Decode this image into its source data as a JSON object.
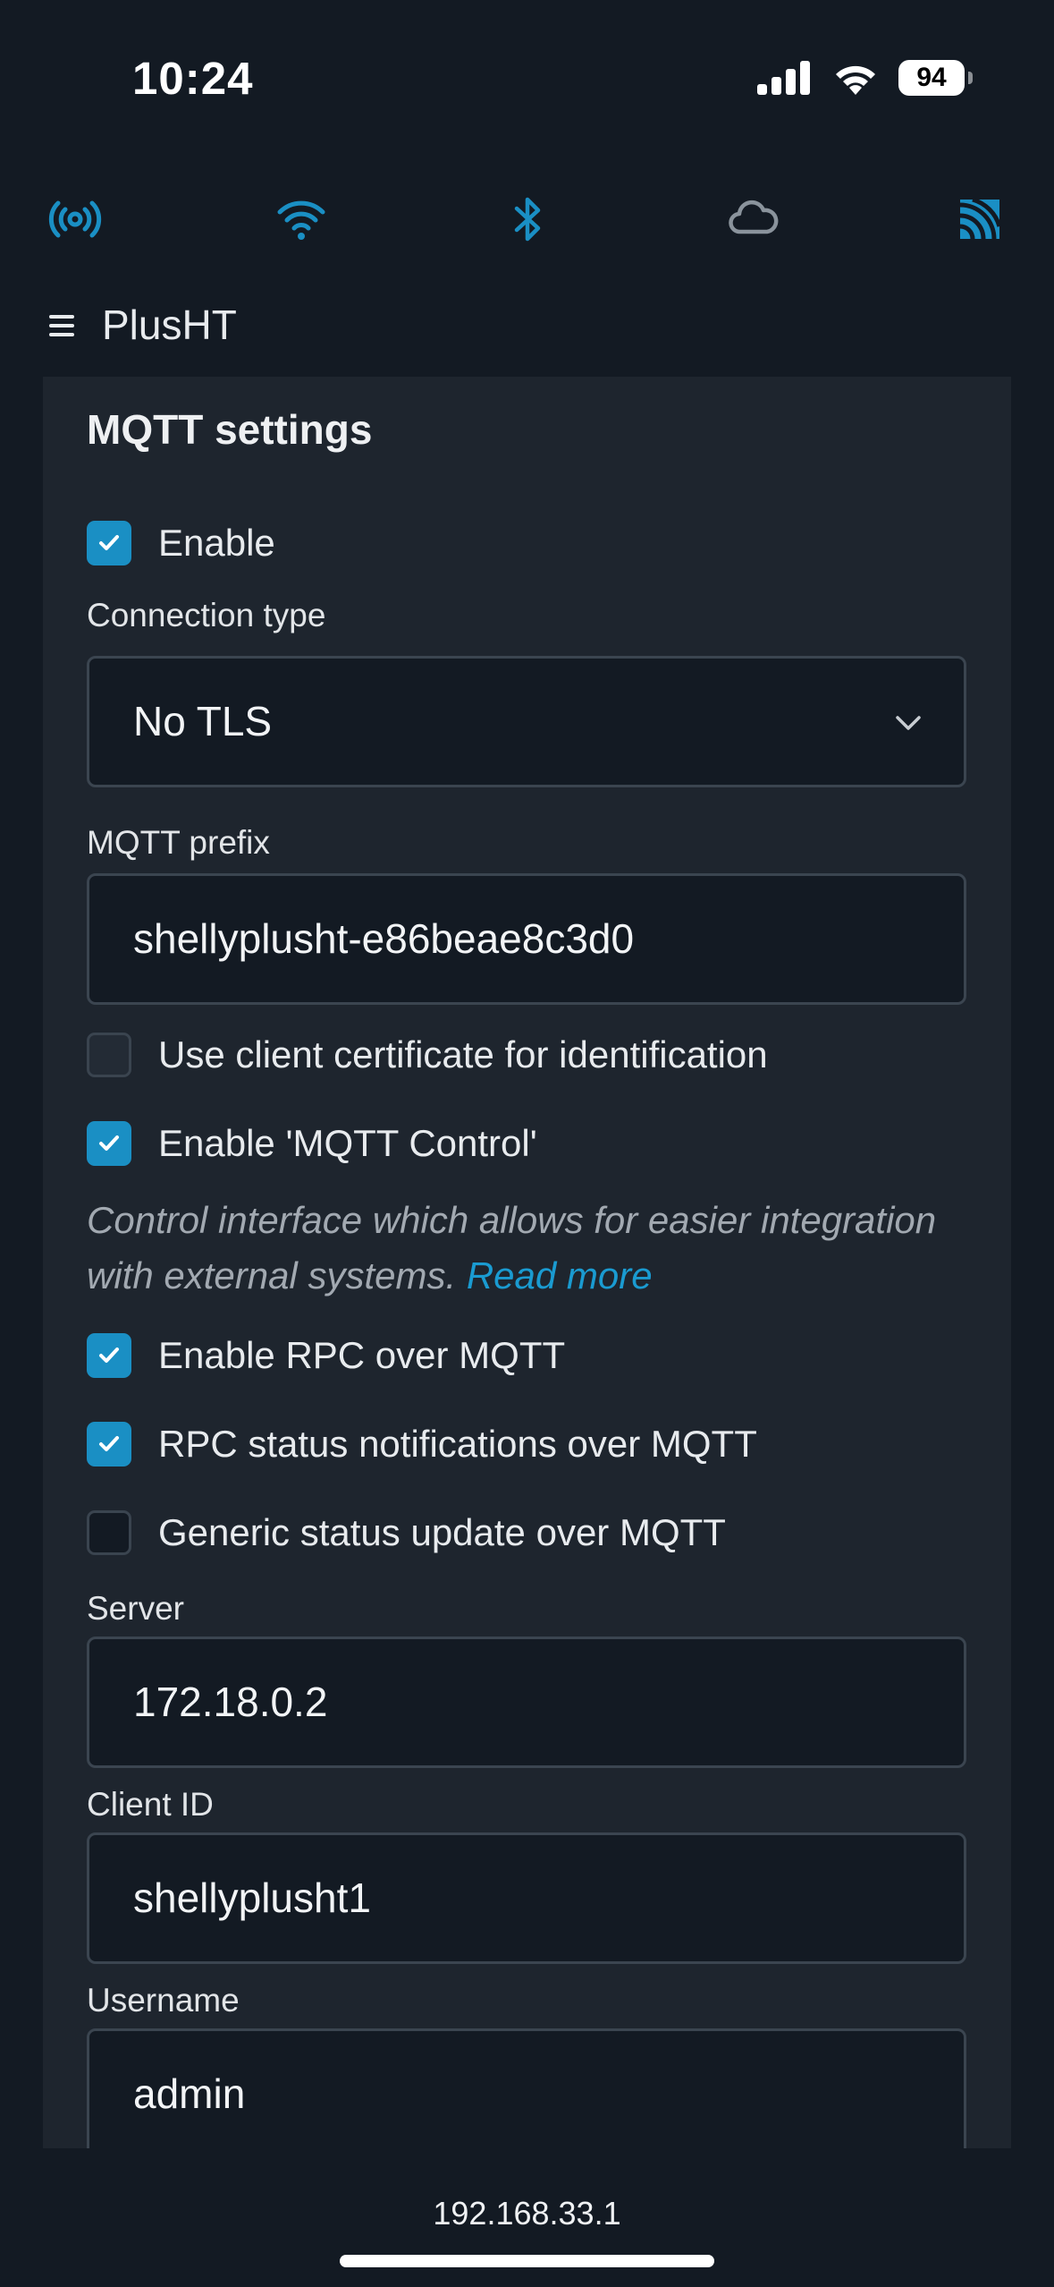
{
  "status_bar": {
    "time": "10:24",
    "battery": "94"
  },
  "connection_icons": [
    "ap-broadcast-icon",
    "wifi-icon",
    "bluetooth-icon",
    "cloud-icon",
    "mqtt-feed-icon"
  ],
  "header": {
    "device_name": "PlusHT"
  },
  "mqtt": {
    "title": "MQTT settings",
    "enable_label": "Enable",
    "connection_type_label": "Connection type",
    "connection_type_value": "No TLS",
    "prefix_label": "MQTT prefix",
    "prefix_value": "shellyplusht-e86beae8c3d0",
    "client_cert_label": "Use client certificate for identification",
    "mqtt_control_label": "Enable 'MQTT Control'",
    "description": "Control interface which allows for easier integration with external systems.",
    "read_more": "Read more",
    "rpc_label": "Enable RPC over MQTT",
    "rpc_notif_label": "RPC status notifications over MQTT",
    "generic_status_label": "Generic status update over MQTT",
    "server_label": "Server",
    "server_value": "172.18.0.2",
    "client_id_label": "Client ID",
    "client_id_value": "shellyplusht1",
    "username_label": "Username",
    "username_value": "admin"
  },
  "footer": {
    "ip": "192.168.33.1"
  },
  "colors": {
    "accent": "#1a8fc4",
    "background": "#131a23",
    "card": "#1e252e"
  }
}
